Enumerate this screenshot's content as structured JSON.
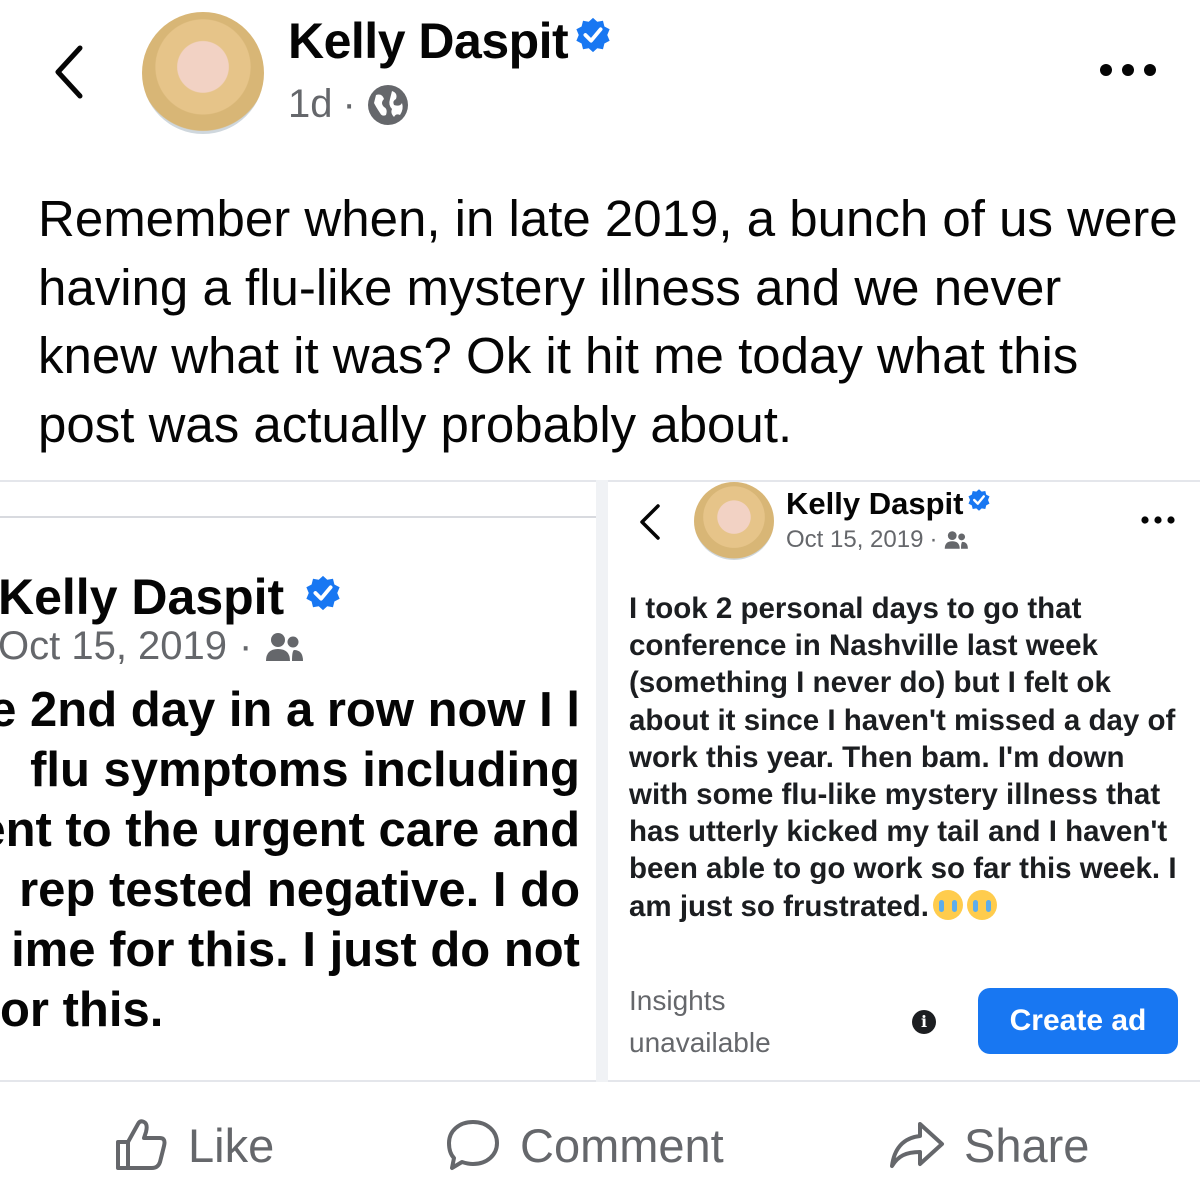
{
  "post": {
    "author": "Kelly Daspit",
    "time": "1d",
    "separator": "·",
    "text": "Remember when, in late 2019, a bunch of us were having a flu-like mystery illness and we never knew what it was? Ok it hit me today what this post was actually probably about."
  },
  "left_screenshot": {
    "author": "Kelly Daspit",
    "date": "Oct 15, 2019",
    "separator": "·",
    "lines": [
      "e 2nd day in a row now I l",
      "flu symptoms including",
      "ent to the urgent care and",
      "rep tested negative. I do",
      "ime for this. I just do not",
      "or this."
    ]
  },
  "right_screenshot": {
    "author": "Kelly Daspit",
    "date": "Oct 15, 2019",
    "separator": "·",
    "text": "I took 2 personal days to go that conference in Nashville last week (something I never do) but I felt ok about it since I haven't missed a day of work this year. Then bam. I'm down with some flu-like mystery illness that has utterly kicked my tail and I haven't been able to go work so far this week. I am just so frustrated.",
    "insights_label": "Insights unavailable",
    "info_glyph": "i",
    "create_ad_label": "Create ad"
  },
  "actions": {
    "like": "Like",
    "comment": "Comment",
    "share": "Share"
  },
  "colors": {
    "verified_blue": "#1877f2",
    "secondary_text": "#65676b",
    "primary_text": "#050505"
  }
}
